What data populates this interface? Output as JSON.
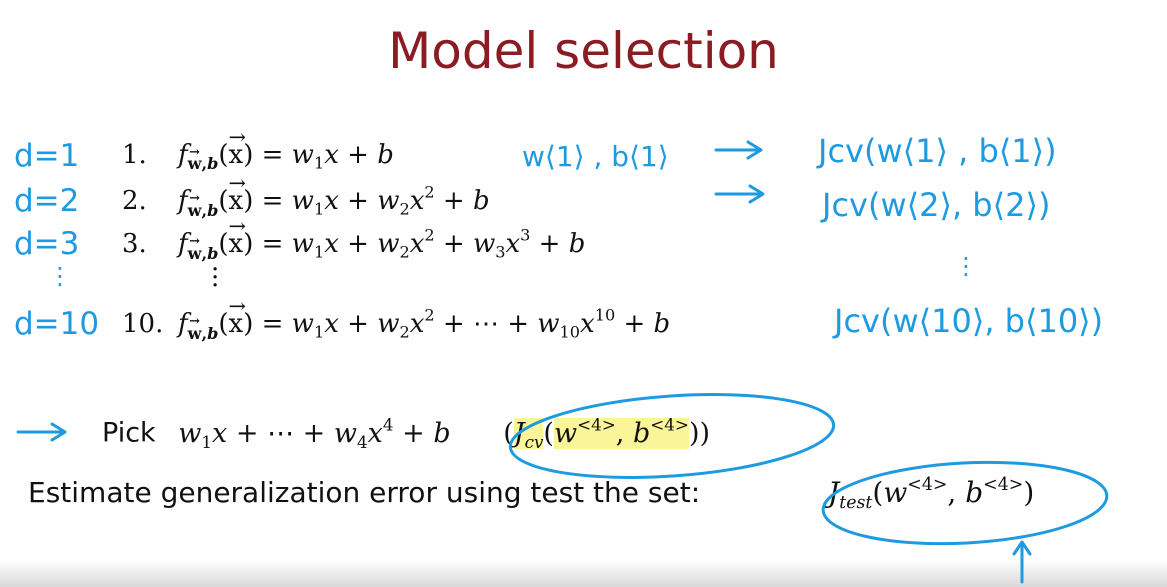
{
  "slide": {
    "title": "Model selection"
  },
  "degree_labels": [
    "d=1",
    "d=2",
    "d=3",
    "⋮",
    "d=10"
  ],
  "equations": [
    {
      "num": "1.",
      "rhs": "w1x + b"
    },
    {
      "num": "2.",
      "rhs": "w1x + w2x2 + b"
    },
    {
      "num": "3.",
      "rhs": "w1x + w2x2 + w3x3 + b"
    },
    {
      "num": "10.",
      "rhs": "w1x + w2x2 + ⋯ + w10x10 + b"
    }
  ],
  "parameters_note": "w⟨1⟩ , b⟨1⟩",
  "cv_costs": [
    "Jcv(w⟨1⟩ , b⟨1⟩)",
    "Jcv(w⟨2⟩, b⟨2⟩)",
    "⋮",
    "Jcv(w⟨10⟩, b⟨10⟩)"
  ],
  "pick": {
    "label": "Pick",
    "model": "w4x4 + b",
    "cost": "Jcv(w<4>, b<4>)"
  },
  "estimate": {
    "text": "Estimate generalization error using test the set:",
    "cost": "Jtest(w<4>, b<4>)"
  },
  "colors": {
    "title": "#8b1c24",
    "annotation": "#1e9be0",
    "highlight": "#fbf59a"
  }
}
